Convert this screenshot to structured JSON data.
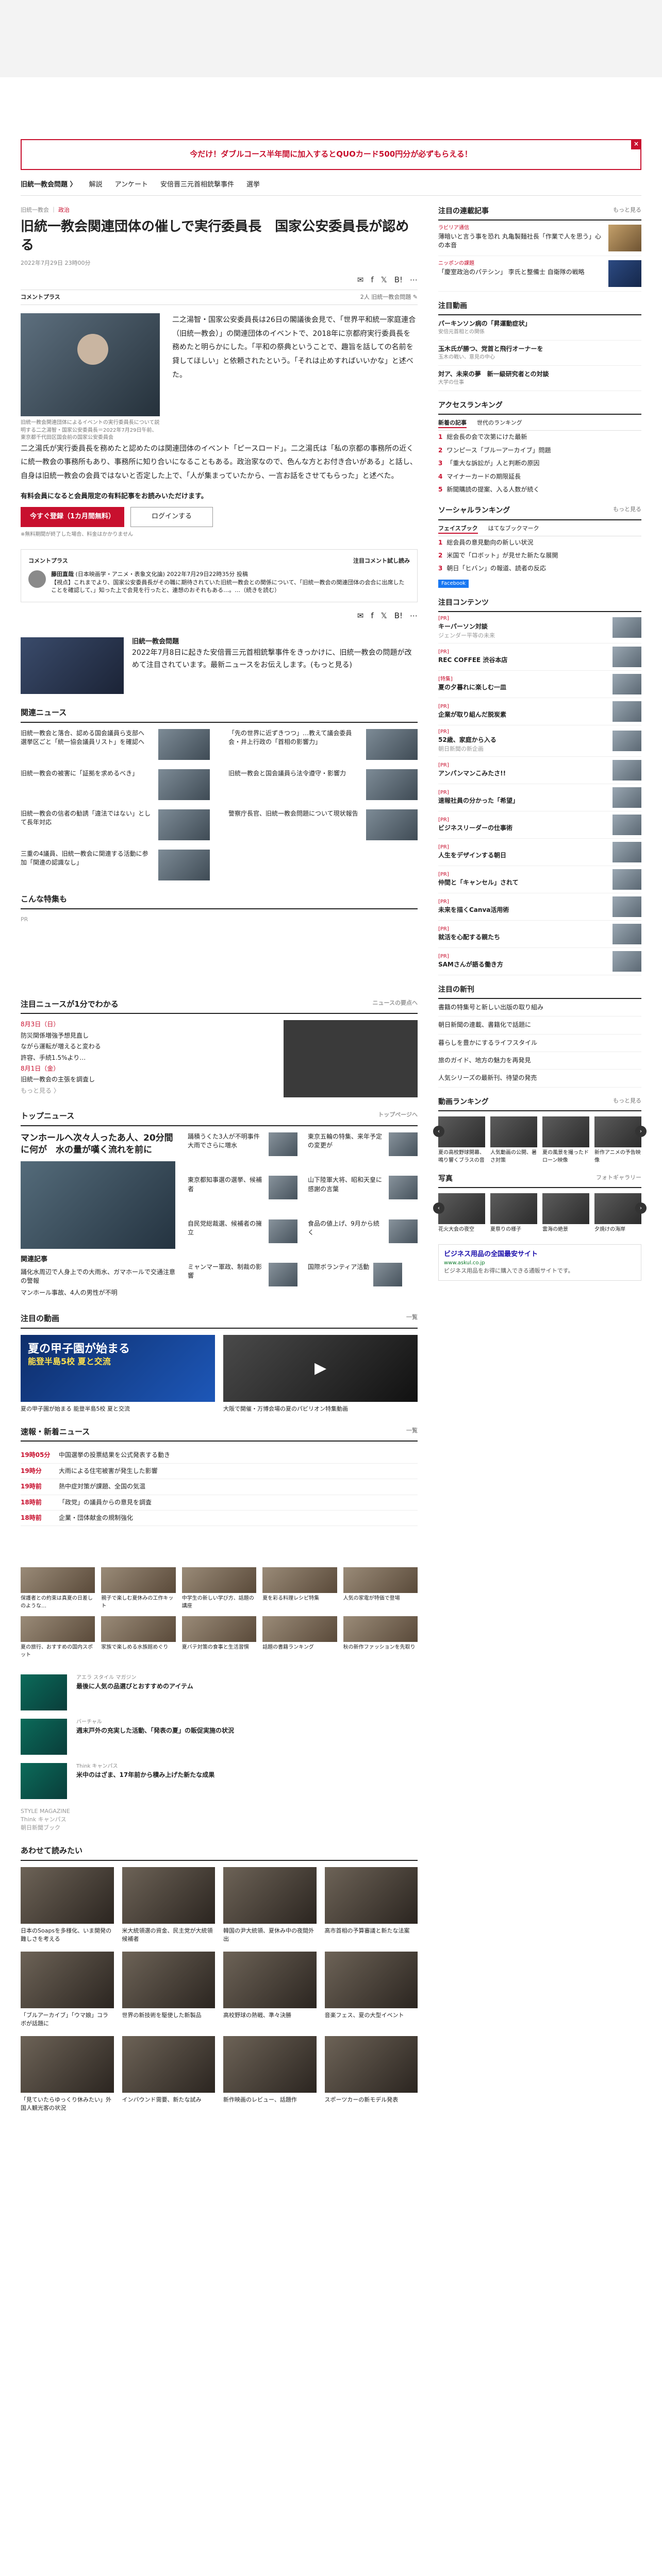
{
  "promo": {
    "text": "今だけ！ダブルコース半年間に加入するとQUOカード500円分が必ずもらえる！",
    "close": "×"
  },
  "gnav": {
    "items": [
      "旧統一教会問題 〉",
      "解説",
      "アンケート",
      "安倍晋三元首相銃撃事件",
      "選挙"
    ]
  },
  "article": {
    "crumb_a": "旧統一教会",
    "crumb_b": "政治",
    "title": "旧統一教会関連団体の催しで実行委員長　国家公安委員長が認める",
    "meta": "2022年7月29日 23時00分",
    "ctp_label": "コメントプラス",
    "ctp_right": "2人 旧統一教会問題 ✎",
    "photo_caption": "旧統一教会関連団体によるイベントの実行委員長について説明する二之湯智・国家公安委員長＝2022年7月29日午前、東京都千代田区国会前の国家公安委員会",
    "p1": "二之湯智・国家公安委員長は26日の閣議後会見で、「世界平和統一家庭連合（旧統一教会）」の関連団体のイベントで、2018年に京都府実行委員長を務めたと明らかにした。「平和の祭典ということで、趣旨を話しての名前を貸してほしい」と依頼されたという。「それは止めすればいいかな」と述べた。",
    "p2": "二之湯氏が実行委員長を務めたと認めたのは関連団体のイベント「ピースロード」。二之湯氏は「私の京都の事務所の近くに統一教会の事務所もあり、事務所に知り合いになることもある。政治家なので、色んな方とお付き合いがある」と話し、自身は旧統一教会の会員ではないと否定した上で、「人が集まっていたから、一言お話をさせてもらった」と述べた。",
    "paywall_title": "有料会員になると会員限定の有料記事をお読みいただけます。",
    "btn_subscribe": "今すぐ登録（1カ月間無料）",
    "btn_login": "ログインする",
    "note": "※無料期間が終了した場合、料金はかかりません"
  },
  "comment": {
    "head": "コメントプラス",
    "right": "注目コメント試し読み",
    "name": "藤田直哉",
    "role": "(日本映画学・アニメ・表象文化論) 2022年7月29日22時35分 投稿",
    "text": "【視点】これまでより、国家公安委員長がその職に期待されていた旧統一教会との関係について、「旧統一教会の関連団体の会合に出席したことを確認して、」知った上で会見を行ったと、連想のおそれもある…。…（続きを読む）"
  },
  "share": {
    "icons": [
      "mail",
      "facebook",
      "x",
      "hatena",
      "more"
    ]
  },
  "feature": {
    "label": "旧統一教会問題",
    "text": "2022年7月8日に起きた安倍晋三元首相銃撃事件をきっかけに、旧統一教会の問題が改めて注目されています。最新ニュースをお伝えします。(もっと見る)"
  },
  "related": {
    "title": "関連ニュース",
    "items": [
      "旧統一教会と落合、認める国会議員ら支部へ　選挙区ごと「統一協会議員リスト」を確認へ",
      "「先の世界に近ずきつつ」…教えて議会委員会・井上行政の「首相の影響力」",
      "旧統一教会の被害に「証拠を求めるべき」",
      "旧統一教会と国会議員ら法令遵守・影響力",
      "旧統一教会の信者の勧誘「違法ではない」として長年対応",
      "警察庁長官、旧統一教会問題について現状報告",
      "三重の4議員、旧統一教会に関連する活動に参加「関連の認識なし」",
      ""
    ]
  },
  "special": {
    "title": "こんな特集も",
    "ad_label": "PR"
  },
  "news1min": {
    "title": "注目ニュースが1分でわかる",
    "more": "ニュースの要点へ",
    "date1": "8月3日（日）",
    "items1": [
      "防災関係増強予想見直し",
      "ながら運転が増えると変わる",
      "許容、手続1.5%より…"
    ],
    "date2": "8月1日（金）",
    "items2": [
      "旧統一教会の主張を調査し"
    ],
    "more2": "もっと見る 〉"
  },
  "topnews": {
    "title": "トップニュース",
    "more": "トップページへ",
    "lead": "マンホールへ次々人ったあ人、20分間に何が　水の量が嘆く流れを前に",
    "grid": [
      "踊積うくた3人が不明事件　大雨でさらに増水",
      "東京五輪の特集、来年予定の変更が",
      "東京都知事選の選挙、候補者",
      "山下陸軍大将、昭和天皇に感謝の言葉",
      "自民党総裁選、候補者の擁立",
      "食品の値上げ、9月から続く",
      "ミャンマー軍政、制裁の影響",
      "国際ボランティア活動"
    ],
    "sub_head": "関連記事",
    "subs": [
      "踊化水周辺で人身上での大雨水、ガマホールで交通注意の警報",
      "マンホール事故、4人の男性が不明"
    ]
  },
  "watch": {
    "title": "注目の動画",
    "more": "一覧",
    "items": [
      "夏の甲子園が始まる 能登半島5校 夏と交流",
      "大阪で開催・万博会場の夏のパビリオン特集動画"
    ],
    "overlay1": "夏の甲子園が始まる",
    "overlay2": "能登半島5校 夏と交流"
  },
  "flash": {
    "title": "速報・新着ニュース",
    "more": "一覧",
    "items": [
      {
        "time": "19時05分",
        "text": "中国選挙の投票結果を公式発表する動き"
      },
      {
        "time": "19時分",
        "text": "大雨による住宅被害が発生した影響"
      },
      {
        "time": "19時前",
        "text": "熱中症対策が課題、全国の気温"
      },
      {
        "time": "18時前",
        "text": "「政党」の議員からの意見を調査"
      },
      {
        "time": "18時前",
        "text": "企業・団体献金の規制強化"
      }
    ]
  },
  "promos": [
    "保護者との約束は真夏の日差しのような…",
    "親子で楽しむ夏休みの工作キット",
    "中学生の新しい学び方、話題の講座",
    "夏を彩る料理レシピ特集",
    "人気の家電が特価で登場",
    "夏の旅行、おすすめの国内スポット",
    "家族で楽しめる水族館めぐり",
    "夏バテ対策の食事と生活習慣",
    "話題の書籍ランキング",
    "秋の新作ファッションを先取り"
  ],
  "brands": [
    {
      "label": "アエラ スタイル マガジン",
      "title": "最後に人気の品選びとおすすめのアイテム"
    },
    {
      "label": "バーチャル",
      "title": "週末戸外の充実した活動、「発表の夏」の販促実施の状況"
    },
    {
      "label": "Think キャンパス",
      "title": "米中のはざま、17年前から積み上げた新たな成果"
    }
  ],
  "brand_logos": [
    "STYLE MAGAZINE",
    "Think キャンパス",
    "朝日新聞ブック"
  ],
  "reco": {
    "title": "あわせて読みたい",
    "items": [
      "日本のSoapsを多様化、いま開発の難しさを考える",
      "米大統領選の資金、民主党が大統領候補者",
      "韓国の尹大統領、夏休み中の夜間外出",
      "高市首相の予算審議と新たな法案",
      "「ブルアーカイブ」「ウマ娘」コラボが話題に",
      "世界の新技術を駆使した新製品",
      "高校野球の熱戦、準々決勝",
      "音楽フェス、夏の大型イベント",
      "「見ていたらゆっくり休みたい」外国人観光客の状況",
      "インバウンド需要、新たな試み",
      "新作映画のレビュー、話題作",
      "スポーツカーの新モデル発表"
    ]
  },
  "side": {
    "attention": {
      "title": "注目の連載記事",
      "more": "もっと見る",
      "items": [
        {
          "tag": "ラビリア通信",
          "title": "薄暗いと言う事を恐れ 丸亀製麺社長「作業で人を思う」心の本音"
        },
        {
          "tag": "ニッポンの課題",
          "title": "「慶室政治のパテシン」 李氏と整備士 自衛隊の戦略"
        }
      ]
    },
    "pickup": {
      "title": "注目動画",
      "items": [
        {
          "title": "パーキンソン病の「昇運動症状」",
          "sub": "安倍元首相との関係"
        },
        {
          "title": "玉木氏が勝つ、党首と飛行オーナーを",
          "sub": "玉木の戦い、意見の中心"
        },
        {
          "title": "対ア、未来の夢　新一級研究者との対談",
          "sub": "大学の仕事"
        }
      ]
    },
    "access": {
      "title": "アクセスランキング",
      "tab1": "新着の記事",
      "tab2": "世代のランキング",
      "items": [
        "総会長の会で次第にけた最新",
        "ワンピース「ブルーアーカイブ」問題",
        "「重大な訴訟が」人と判断の原因",
        "マイナーカードの期限延長",
        "新聞購読の提案、入る人数が続く"
      ]
    },
    "social": {
      "title": "ソーシャルランキング",
      "more": "もっと見る",
      "tab1": "フェイスブック",
      "tab2": "はてなブックマーク",
      "items": [
        "総会員の意見動向の新しい状況",
        "米国で「ロボット」が見せた新たな展開",
        "朝日「ヒバン」の報道、読者の反応"
      ],
      "fb": "Facebook"
    },
    "contents": {
      "title": "注目コンテンツ",
      "items": [
        {
          "tag": "[PR]",
          "title": "キーパーソン対談",
          "sub": "ジェンダー平等の未来"
        },
        {
          "tag": "[PR]",
          "title": "REC COFFEE 渋谷本店",
          "sub": ""
        },
        {
          "tag": "[特集]",
          "title": "夏の夕暮れに楽しむ一皿",
          "sub": ""
        },
        {
          "tag": "[PR]",
          "title": "企業が取り組んだ脱炭素",
          "sub": ""
        },
        {
          "tag": "[PR]",
          "title": "52歳、家庭から入る",
          "sub": "朝日新聞の新企画"
        },
        {
          "tag": "[PR]",
          "title": "アンパンマンこみたさ!!",
          "sub": ""
        },
        {
          "tag": "[PR]",
          "title": "速報社員の分かった「希望」",
          "sub": ""
        },
        {
          "tag": "[PR]",
          "title": "ビジネスリーダーの仕事術",
          "sub": ""
        },
        {
          "tag": "[PR]",
          "title": "人生をデザインする朝日",
          "sub": ""
        },
        {
          "tag": "[PR]",
          "title": "仲間と「キャンセル」されて",
          "sub": ""
        },
        {
          "tag": "[PR]",
          "title": "未来を描くCanva活用術",
          "sub": ""
        },
        {
          "tag": "[PR]",
          "title": "就活を心配する親たち",
          "sub": ""
        },
        {
          "tag": "[PR]",
          "title": "SAMさんが語る働き方",
          "sub": ""
        }
      ]
    },
    "ranking": {
      "title": "動画ランキング",
      "more": "もっと見る",
      "items": [
        "夏の高校野球開幕、鳴り響くブラスの音",
        "人気動画の公開、暑さ対策",
        "夏の風景を撮ったドローン映像",
        "新作アニメの予告映像"
      ]
    },
    "photos": {
      "title": "写真",
      "more": "フォトギャラリー",
      "items": [
        "花火大会の夜空",
        "夏祭りの様子",
        "雲海の絶景",
        "夕焼けの海岸"
      ]
    },
    "news_grouped": {
      "title": "注目の新刊",
      "items": [
        "書籍の特集号と新しい出版の取り組み",
        "朝日新聞の連載、書籍化で話題に",
        "暮らしを豊かにするライフスタイル",
        "旅のガイド、地方の魅力を再発見",
        "人気シリーズの最新刊、待望の発売"
      ]
    },
    "ad": {
      "title": "ビジネス用品の全国最安サイト",
      "url": "www.askul.co.jp",
      "desc": "ビジネス用品をお得に購入できる通販サイトです。"
    }
  }
}
